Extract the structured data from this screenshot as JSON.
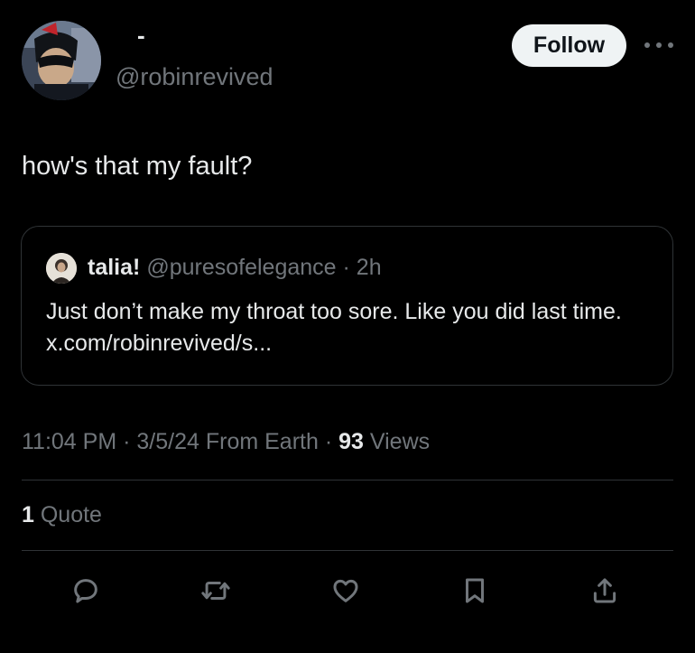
{
  "author": {
    "display_name": "-",
    "handle": "@robinrevived",
    "follow_label": "Follow"
  },
  "tweet": {
    "text": "how's that my fault?"
  },
  "quote": {
    "name": "talia!",
    "handle": "@puresofelegance",
    "separator": "·",
    "time": "2h",
    "text": "Just don’t make my throat too sore. Like you did last time. x.com/robinrevived/s..."
  },
  "meta": {
    "time": "11:04 PM",
    "sep1": "·",
    "date": "3/5/24",
    "source": "From Earth",
    "sep2": "·",
    "views_count": "93",
    "views_label": "Views"
  },
  "stats": {
    "quotes_count": "1",
    "quotes_label": "Quote"
  },
  "actions": [
    "reply-icon",
    "retweet-icon",
    "like-icon",
    "bookmark-icon",
    "share-icon"
  ],
  "colors": {
    "background": "#000000",
    "text_primary": "#e7e9ea",
    "text_secondary": "#71767b",
    "border": "#2f3336",
    "follow_bg": "#eff3f4"
  }
}
